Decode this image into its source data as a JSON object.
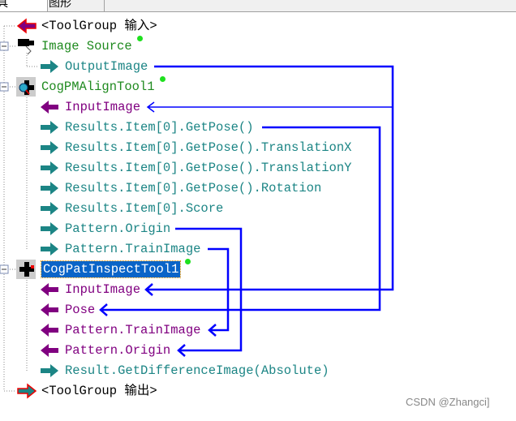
{
  "tabs": [
    {
      "label": "具"
    },
    {
      "label": "图形"
    }
  ],
  "tree": [
    {
      "label": "<ToolGroup 输入>",
      "color": "black",
      "icon": "input-arrow-icon"
    },
    {
      "label": "Image Source",
      "color": "green",
      "icon": "camera-icon",
      "status": "green-dot"
    },
    {
      "label": "OutputImage",
      "color": "teal",
      "icon": "output-arrow-icon"
    },
    {
      "label": "CogPMAlignTool1",
      "color": "green",
      "icon": "pmalign-tool-icon",
      "status": "green-dot"
    },
    {
      "label": "InputImage",
      "color": "purple",
      "icon": "input-arrow-icon"
    },
    {
      "label": "Results.Item[0].GetPose()",
      "color": "teal",
      "icon": "output-arrow-icon"
    },
    {
      "label": "Results.Item[0].GetPose().TranslationX",
      "color": "teal",
      "icon": "output-arrow-icon"
    },
    {
      "label": "Results.Item[0].GetPose().TranslationY",
      "color": "teal",
      "icon": "output-arrow-icon"
    },
    {
      "label": "Results.Item[0].GetPose().Rotation",
      "color": "teal",
      "icon": "output-arrow-icon"
    },
    {
      "label": "Results.Item[0].Score",
      "color": "teal",
      "icon": "output-arrow-icon"
    },
    {
      "label": "Pattern.Origin",
      "color": "teal",
      "icon": "output-arrow-icon"
    },
    {
      "label": "Pattern.TrainImage",
      "color": "teal",
      "icon": "output-arrow-icon"
    },
    {
      "label": "CogPatInspectTool1",
      "color": "green",
      "icon": "patinspect-tool-icon",
      "status": "green-dot",
      "selected": true
    },
    {
      "label": "InputImage",
      "color": "purple",
      "icon": "input-arrow-icon"
    },
    {
      "label": "Pose",
      "color": "purple",
      "icon": "input-arrow-icon"
    },
    {
      "label": "Pattern.TrainImage",
      "color": "purple",
      "icon": "input-arrow-icon"
    },
    {
      "label": "Pattern.Origin",
      "color": "purple",
      "icon": "input-arrow-icon"
    },
    {
      "label": "Result.GetDifferenceImage(Absolute)",
      "color": "teal",
      "icon": "output-arrow-icon"
    },
    {
      "label": "<ToolGroup 输出>",
      "color": "black",
      "icon": "output-arrow-icon"
    }
  ],
  "colors": {
    "link": "#0000ff",
    "teal": "#1c8585",
    "purple": "#800080",
    "green": "#1f8a1f",
    "selection": "#0a64c8"
  },
  "watermark": "CSDN @Zhangci]"
}
